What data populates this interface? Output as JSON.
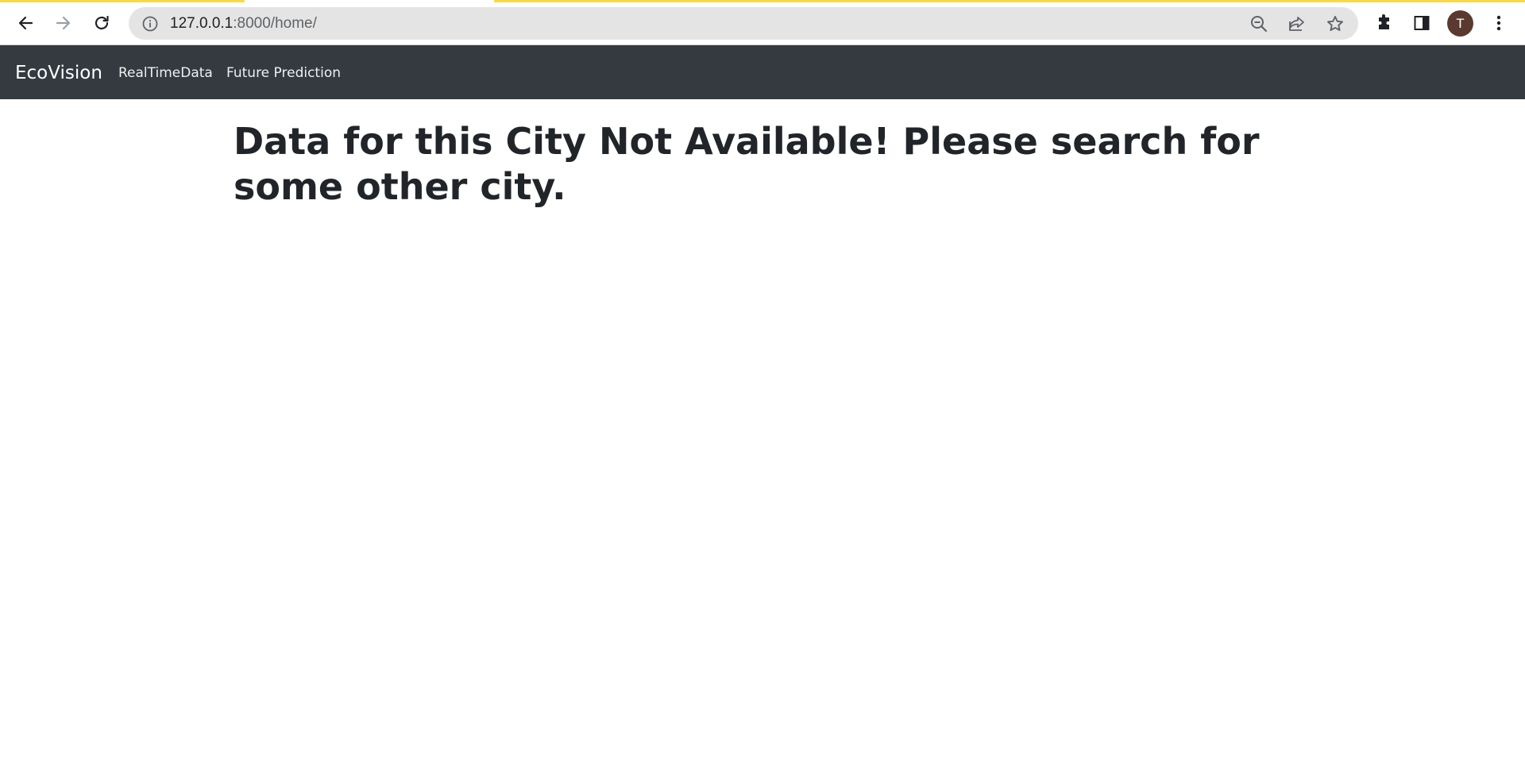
{
  "browser": {
    "url_host": "127.0.0.1",
    "url_rest": ":8000/home/",
    "profile_initial": "T",
    "icons": [
      "back-icon",
      "forward-icon",
      "reload-icon",
      "info-icon",
      "zoom-out-icon",
      "share-icon",
      "star-icon",
      "extensions-icon",
      "side-panel-icon",
      "menu-icon"
    ]
  },
  "navbar": {
    "brand": "EcoVision",
    "links": [
      {
        "label": "RealTimeData"
      },
      {
        "label": "Future Prediction"
      }
    ],
    "background": "#343a40"
  },
  "main": {
    "message": "Data for this City Not Available! Please search for some other city."
  },
  "colors": {
    "loading_bar": "#f9d84a",
    "text": "#212529",
    "avatar": "#5a3a30"
  }
}
